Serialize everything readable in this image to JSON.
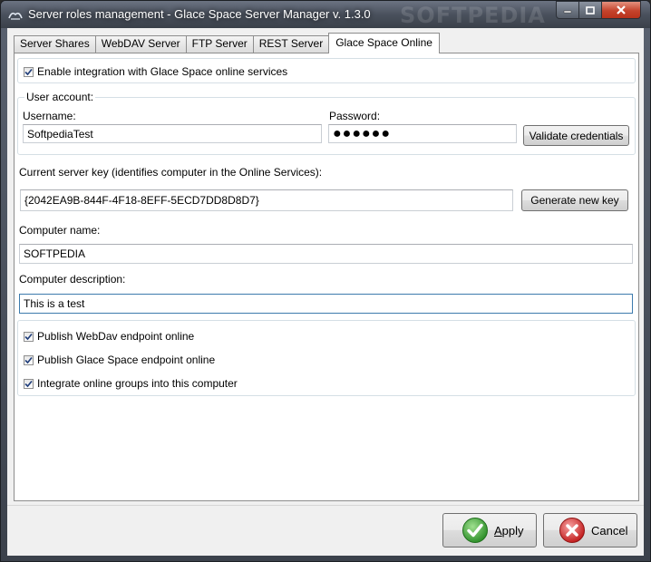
{
  "window": {
    "title": "Server roles management - Glace Space Server Manager v. 1.3.0",
    "watermark": "SOFTPEDIA"
  },
  "tabs": [
    {
      "label": "Server Shares",
      "active": false
    },
    {
      "label": "WebDAV Server",
      "active": false
    },
    {
      "label": "FTP Server",
      "active": false
    },
    {
      "label": "REST Server",
      "active": false
    },
    {
      "label": "Glace Space Online",
      "active": true
    }
  ],
  "integration": {
    "enable_label": "Enable integration with Glace Space online services",
    "enabled": true
  },
  "user_account": {
    "group_label": "User account:",
    "username_label": "Username:",
    "username_value": "SoftpediaTest",
    "password_label": "Password:",
    "password_value": "●●●●●●",
    "validate_button": "Validate credentials"
  },
  "server_key": {
    "label": "Current server key (identifies computer in the Online Services):",
    "value": "{2042EA9B-844F-4F18-8EFF-5ECD7DD8D8D7}",
    "generate_button": "Generate new key"
  },
  "computer": {
    "name_label": "Computer name:",
    "name_value": "SOFTPEDIA",
    "description_label": "Computer description:",
    "description_value": "This is a test"
  },
  "options": [
    {
      "label": "Publish WebDav endpoint online",
      "checked": true
    },
    {
      "label": "Publish Glace Space endpoint online",
      "checked": true
    },
    {
      "label": "Integrate online groups into this computer",
      "checked": true
    }
  ],
  "footer": {
    "apply_prefix": "",
    "apply_mnemonic": "A",
    "apply_rest": "pply",
    "cancel_button": "Cancel"
  },
  "colors": {
    "check": "#1f3d7a",
    "apply_icon": "#3aa534",
    "cancel_icon": "#d42a2a"
  },
  "icons": {
    "app": "app-icon",
    "minimize": "minimize-icon",
    "maximize": "maximize-icon",
    "close": "close-icon",
    "apply": "checkmark-icon",
    "cancel": "cancel-icon"
  }
}
